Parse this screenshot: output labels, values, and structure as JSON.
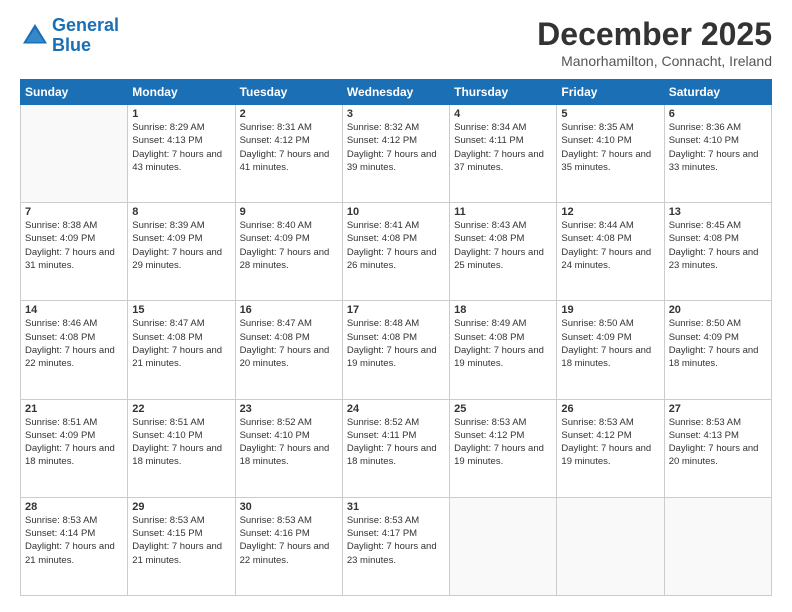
{
  "header": {
    "logo_line1": "General",
    "logo_line2": "Blue",
    "month": "December 2025",
    "location": "Manorhamilton, Connacht, Ireland"
  },
  "days_of_week": [
    "Sunday",
    "Monday",
    "Tuesday",
    "Wednesday",
    "Thursday",
    "Friday",
    "Saturday"
  ],
  "weeks": [
    [
      {
        "day": "",
        "sunrise": "",
        "sunset": "",
        "daylight": ""
      },
      {
        "day": "1",
        "sunrise": "Sunrise: 8:29 AM",
        "sunset": "Sunset: 4:13 PM",
        "daylight": "Daylight: 7 hours and 43 minutes."
      },
      {
        "day": "2",
        "sunrise": "Sunrise: 8:31 AM",
        "sunset": "Sunset: 4:12 PM",
        "daylight": "Daylight: 7 hours and 41 minutes."
      },
      {
        "day": "3",
        "sunrise": "Sunrise: 8:32 AM",
        "sunset": "Sunset: 4:12 PM",
        "daylight": "Daylight: 7 hours and 39 minutes."
      },
      {
        "day": "4",
        "sunrise": "Sunrise: 8:34 AM",
        "sunset": "Sunset: 4:11 PM",
        "daylight": "Daylight: 7 hours and 37 minutes."
      },
      {
        "day": "5",
        "sunrise": "Sunrise: 8:35 AM",
        "sunset": "Sunset: 4:10 PM",
        "daylight": "Daylight: 7 hours and 35 minutes."
      },
      {
        "day": "6",
        "sunrise": "Sunrise: 8:36 AM",
        "sunset": "Sunset: 4:10 PM",
        "daylight": "Daylight: 7 hours and 33 minutes."
      }
    ],
    [
      {
        "day": "7",
        "sunrise": "Sunrise: 8:38 AM",
        "sunset": "Sunset: 4:09 PM",
        "daylight": "Daylight: 7 hours and 31 minutes."
      },
      {
        "day": "8",
        "sunrise": "Sunrise: 8:39 AM",
        "sunset": "Sunset: 4:09 PM",
        "daylight": "Daylight: 7 hours and 29 minutes."
      },
      {
        "day": "9",
        "sunrise": "Sunrise: 8:40 AM",
        "sunset": "Sunset: 4:09 PM",
        "daylight": "Daylight: 7 hours and 28 minutes."
      },
      {
        "day": "10",
        "sunrise": "Sunrise: 8:41 AM",
        "sunset": "Sunset: 4:08 PM",
        "daylight": "Daylight: 7 hours and 26 minutes."
      },
      {
        "day": "11",
        "sunrise": "Sunrise: 8:43 AM",
        "sunset": "Sunset: 4:08 PM",
        "daylight": "Daylight: 7 hours and 25 minutes."
      },
      {
        "day": "12",
        "sunrise": "Sunrise: 8:44 AM",
        "sunset": "Sunset: 4:08 PM",
        "daylight": "Daylight: 7 hours and 24 minutes."
      },
      {
        "day": "13",
        "sunrise": "Sunrise: 8:45 AM",
        "sunset": "Sunset: 4:08 PM",
        "daylight": "Daylight: 7 hours and 23 minutes."
      }
    ],
    [
      {
        "day": "14",
        "sunrise": "Sunrise: 8:46 AM",
        "sunset": "Sunset: 4:08 PM",
        "daylight": "Daylight: 7 hours and 22 minutes."
      },
      {
        "day": "15",
        "sunrise": "Sunrise: 8:47 AM",
        "sunset": "Sunset: 4:08 PM",
        "daylight": "Daylight: 7 hours and 21 minutes."
      },
      {
        "day": "16",
        "sunrise": "Sunrise: 8:47 AM",
        "sunset": "Sunset: 4:08 PM",
        "daylight": "Daylight: 7 hours and 20 minutes."
      },
      {
        "day": "17",
        "sunrise": "Sunrise: 8:48 AM",
        "sunset": "Sunset: 4:08 PM",
        "daylight": "Daylight: 7 hours and 19 minutes."
      },
      {
        "day": "18",
        "sunrise": "Sunrise: 8:49 AM",
        "sunset": "Sunset: 4:08 PM",
        "daylight": "Daylight: 7 hours and 19 minutes."
      },
      {
        "day": "19",
        "sunrise": "Sunrise: 8:50 AM",
        "sunset": "Sunset: 4:09 PM",
        "daylight": "Daylight: 7 hours and 18 minutes."
      },
      {
        "day": "20",
        "sunrise": "Sunrise: 8:50 AM",
        "sunset": "Sunset: 4:09 PM",
        "daylight": "Daylight: 7 hours and 18 minutes."
      }
    ],
    [
      {
        "day": "21",
        "sunrise": "Sunrise: 8:51 AM",
        "sunset": "Sunset: 4:09 PM",
        "daylight": "Daylight: 7 hours and 18 minutes."
      },
      {
        "day": "22",
        "sunrise": "Sunrise: 8:51 AM",
        "sunset": "Sunset: 4:10 PM",
        "daylight": "Daylight: 7 hours and 18 minutes."
      },
      {
        "day": "23",
        "sunrise": "Sunrise: 8:52 AM",
        "sunset": "Sunset: 4:10 PM",
        "daylight": "Daylight: 7 hours and 18 minutes."
      },
      {
        "day": "24",
        "sunrise": "Sunrise: 8:52 AM",
        "sunset": "Sunset: 4:11 PM",
        "daylight": "Daylight: 7 hours and 18 minutes."
      },
      {
        "day": "25",
        "sunrise": "Sunrise: 8:53 AM",
        "sunset": "Sunset: 4:12 PM",
        "daylight": "Daylight: 7 hours and 19 minutes."
      },
      {
        "day": "26",
        "sunrise": "Sunrise: 8:53 AM",
        "sunset": "Sunset: 4:12 PM",
        "daylight": "Daylight: 7 hours and 19 minutes."
      },
      {
        "day": "27",
        "sunrise": "Sunrise: 8:53 AM",
        "sunset": "Sunset: 4:13 PM",
        "daylight": "Daylight: 7 hours and 20 minutes."
      }
    ],
    [
      {
        "day": "28",
        "sunrise": "Sunrise: 8:53 AM",
        "sunset": "Sunset: 4:14 PM",
        "daylight": "Daylight: 7 hours and 21 minutes."
      },
      {
        "day": "29",
        "sunrise": "Sunrise: 8:53 AM",
        "sunset": "Sunset: 4:15 PM",
        "daylight": "Daylight: 7 hours and 21 minutes."
      },
      {
        "day": "30",
        "sunrise": "Sunrise: 8:53 AM",
        "sunset": "Sunset: 4:16 PM",
        "daylight": "Daylight: 7 hours and 22 minutes."
      },
      {
        "day": "31",
        "sunrise": "Sunrise: 8:53 AM",
        "sunset": "Sunset: 4:17 PM",
        "daylight": "Daylight: 7 hours and 23 minutes."
      },
      {
        "day": "",
        "sunrise": "",
        "sunset": "",
        "daylight": ""
      },
      {
        "day": "",
        "sunrise": "",
        "sunset": "",
        "daylight": ""
      },
      {
        "day": "",
        "sunrise": "",
        "sunset": "",
        "daylight": ""
      }
    ]
  ]
}
